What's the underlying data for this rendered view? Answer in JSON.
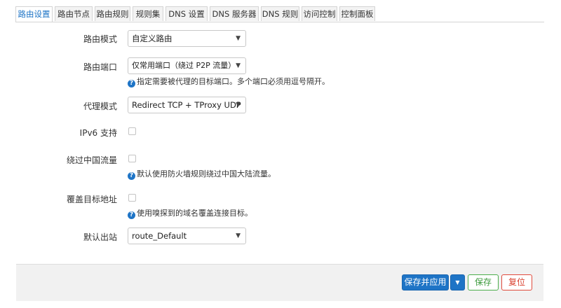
{
  "tabs": [
    {
      "label": "路由设置",
      "active": true
    },
    {
      "label": "路由节点",
      "active": false
    },
    {
      "label": "路由规则",
      "active": false
    },
    {
      "label": "规则集",
      "active": false
    },
    {
      "label": "DNS 设置",
      "active": false
    },
    {
      "label": "DNS 服务器",
      "active": false
    },
    {
      "label": "DNS 规则",
      "active": false
    },
    {
      "label": "访问控制",
      "active": false
    },
    {
      "label": "控制面板",
      "active": false
    }
  ],
  "form": {
    "route_mode": {
      "label": "路由模式",
      "value": "自定义路由"
    },
    "route_ports": {
      "label": "路由端口",
      "value": "仅常用端口（绕过 P2P 流量）",
      "hint": "指定需要被代理的目标端口。多个端口必须用逗号隔开。"
    },
    "proxy_mode": {
      "label": "代理模式",
      "value": "Redirect TCP + TProxy UDP"
    },
    "ipv6": {
      "label": "IPv6 支持",
      "checked": false
    },
    "bypass_cn": {
      "label": "绕过中国流量",
      "checked": false,
      "hint": "默认使用防火墙规则绕过中国大陆流量。"
    },
    "override_dest": {
      "label": "覆盖目标地址",
      "checked": false,
      "hint": "使用嗅探到的域名覆盖连接目标。"
    },
    "default_outbound": {
      "label": "默认出站",
      "value": "route_Default"
    }
  },
  "icons": {
    "hint": "help-icon",
    "caret": "chevron-down-icon"
  },
  "footer": {
    "save_apply": "保存并应用",
    "save": "保存",
    "reset": "复位"
  },
  "colors": {
    "accent": "#1e74c6",
    "save": "#4cae4c",
    "reset": "#e04a3c"
  }
}
